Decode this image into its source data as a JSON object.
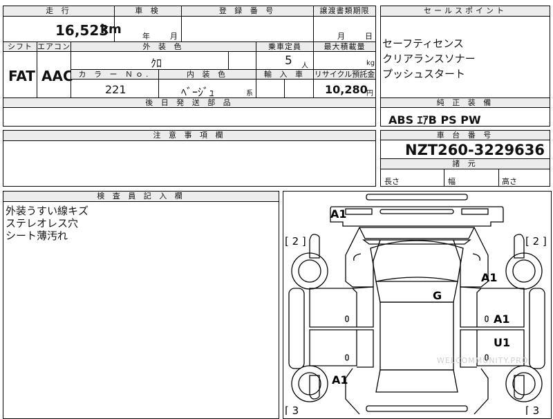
{
  "sheet": {
    "mileage": {
      "label": "走 行",
      "value": "16,523",
      "unit": "km"
    },
    "inspection": {
      "label": "車 検",
      "year_unit": "年",
      "month_unit": "月"
    },
    "registration": {
      "label": "登 録 番 号"
    },
    "transfer_deadline": {
      "label": "譲渡書類期限",
      "month_unit": "月",
      "day_unit": "日"
    },
    "shift": {
      "label": "シフト",
      "value": "FAT"
    },
    "aircon": {
      "label": "エアコン",
      "value": "AAC"
    },
    "exterior_color": {
      "label": "外 装 色",
      "value": "ｸﾛ"
    },
    "capacity": {
      "label": "乗車定員",
      "value": "5",
      "unit": "人"
    },
    "max_load": {
      "label": "最大積載量",
      "unit": "kg"
    },
    "color_no": {
      "label": "カ ラ ー Ｎｏ.",
      "value": "221"
    },
    "interior_color": {
      "label": "内 装 色",
      "value": "ﾍﾞｰｼﾞｭ",
      "suffix": "系"
    },
    "import": {
      "label": "輸 入 車"
    },
    "recycle": {
      "label": "リサイクル預託金",
      "value": "10,280",
      "unit": "円"
    },
    "later_parts": {
      "label": "後 日 発 送 部 品"
    },
    "cautions": {
      "label": "注 意 事 項 欄"
    },
    "inspector_notes": {
      "label": "検 査 員 記 入 欄",
      "lines": [
        "外装うすい線キズ",
        "ステレオレス穴",
        "シート薄汚れ"
      ]
    }
  },
  "sales_points": {
    "label": "セールスポイント",
    "items": [
      "セーフティセンス",
      "クリアランスソナー",
      "プッシュスタート"
    ]
  },
  "standard_equipment": {
    "label": "純 正 装 備",
    "value": "ABS ｴｱB PS PW"
  },
  "chassis": {
    "label": "車 台 番 号",
    "value": "NZT260-3229636"
  },
  "dimensions": {
    "label": "諸 元",
    "length": "長さ",
    "width": "幅",
    "height": "高さ"
  },
  "diagram": {
    "marks": [
      "A1",
      "A1",
      "A1",
      "U1",
      "A1",
      "G"
    ],
    "panel_left_top": "[ 2 ]",
    "panel_right_top": "[ 2 ]",
    "panel_left_bottom": "[ 3",
    "panel_right_bottom": "[ 3",
    "watermark": "WELCOMMUNITY.PRO"
  }
}
